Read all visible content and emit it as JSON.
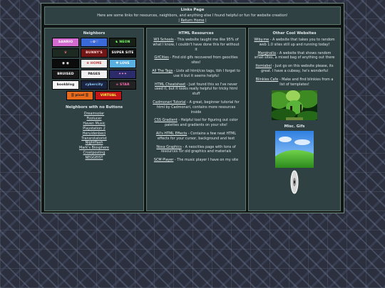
{
  "header": {
    "title": "Links Page",
    "intro": "Here are some links for resources, neighbors, and anything else I found helpful or fun for website creation!",
    "return_prefix": "| ",
    "return_label": "Return Home",
    "return_suffix": " |"
  },
  "left": {
    "neighbors_title": "Neighbors",
    "buttons": [
      {
        "label": "SANRIO",
        "bg": "#d36bd0",
        "fg": "#ffffff"
      },
      {
        "label": "☆✿♡",
        "bg": "#3a6ad8",
        "fg": "#ffe3ff"
      },
      {
        "label": "♞ NEON",
        "bg": "#162016",
        "fg": "#7cff6a"
      },
      {
        "label": "♛",
        "bg": "#1c2a22",
        "fg": "#ff7373"
      },
      {
        "label": "BUNNY'S",
        "bg": "#701616",
        "fg": "#ffd1d1"
      },
      {
        "label": "SUPER SITE",
        "bg": "#101010",
        "fg": "#ffffff"
      },
      {
        "label": "◉ ◉",
        "bg": "#0c0c0c",
        "fg": "#ffffff"
      },
      {
        "label": "❀ HOME",
        "bg": "#ededed",
        "fg": "#c43b3b"
      },
      {
        "label": "♥ LOVE",
        "bg": "#5ab0e0",
        "fg": "#ffffff"
      },
      {
        "label": "BRUISED",
        "bg": "#181818",
        "fg": "#ffffff"
      },
      {
        "label": "PAGES",
        "bg": "#f0f0f0",
        "fg": "#222222"
      },
      {
        "label": "✦✦✦",
        "bg": "#2b2b6a",
        "fg": "#ff9bd6"
      },
      {
        "label": "bookblog",
        "bg": "#f6f6f6",
        "fg": "#222222"
      },
      {
        "label": "cybercity",
        "bg": "#1b2440",
        "fg": "#8fd3ff"
      },
      {
        "label": "∞ STAR",
        "bg": "#222222",
        "fg": "#ff6ab4"
      },
      {
        "label": "▒ pixel ▒",
        "bg": "#e86a1c",
        "fg": "#1d1d1d"
      },
      {
        "label": "VIRTUAL",
        "bg": "#c01818",
        "fg": "#ffff40"
      }
    ],
    "no_button_title": "Neighbors with no Buttons",
    "no_button_links": [
      "Dreamsolar",
      "Fizzlucer",
      "Haven Music",
      "Playstation 2",
      "Heruidenbeci",
      "Transrotatorist",
      "Nightflash",
      "Mark's Biosphere",
      "Crostposting",
      "NEGGEIST"
    ]
  },
  "middle": {
    "title": "HTML Resources",
    "resources": [
      {
        "name": "W3 Schools",
        "desc": " - This website taught me like 95% of what I know, I couldn't have done this for without it"
      },
      {
        "name": "GifCities",
        "desc": " - Find old gifs recovered from geocities sites!"
      },
      {
        "name": "All The Tags",
        "desc": " - Lists all html/css tags, tbh I forget to use it but it seems helpful"
      },
      {
        "name": "HTML Cheatsheet",
        "desc": " - Just found this so I've never used it, but it looks really helpful for tricky html stuff"
      },
      {
        "name": "Cadmonari Tutorial",
        "desc": " - A great, beginner tutorial for html by Cadmonari, contains more resources inside"
      },
      {
        "name": "CSS Gradient",
        "desc": " - Helpful tool for figuring out color palettes and gradients on your site!"
      },
      {
        "name": "Ali's HTML Effects",
        "desc": " - Contains a few neat HTML effects for your cursor, background and text"
      },
      {
        "name": "Nosa Graphics",
        "desc": " - A neocities page with tons of resources for old graphics and materials"
      },
      {
        "name": "SCM Player",
        "desc": " - The music player I have on my site"
      }
    ]
  },
  "right": {
    "title": "Other Cool Websites",
    "sites": [
      {
        "name": "Wiby.me",
        "desc": " - A website that takes you to random web 1.0 sites still up and running today!"
      },
      {
        "name": "Marginalia",
        "desc": " - A website that shows random small sites, a mixed bag of anything out there"
      },
      {
        "name": "Itsmiabel",
        "desc": " - Just go on this website please, its great. I have a cubeay, he's wonderful"
      },
      {
        "name": "Blinkies Cafe",
        "desc": " - Make and find blinkies from a list of templates!"
      }
    ],
    "gifs_title": "Misc. Gifs"
  }
}
